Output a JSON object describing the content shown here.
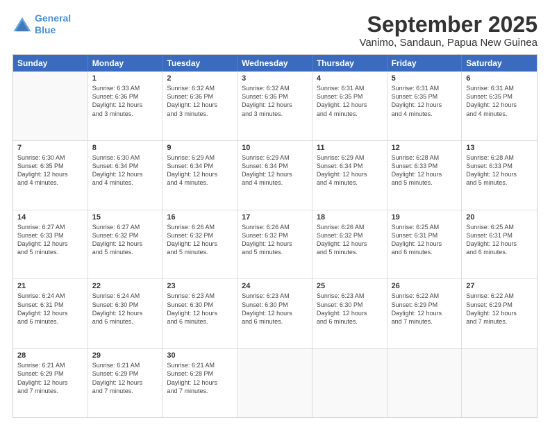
{
  "logo": {
    "line1": "General",
    "line2": "Blue"
  },
  "title": "September 2025",
  "subtitle": "Vanimo, Sandaun, Papua New Guinea",
  "header_days": [
    "Sunday",
    "Monday",
    "Tuesday",
    "Wednesday",
    "Thursday",
    "Friday",
    "Saturday"
  ],
  "weeks": [
    [
      {
        "day": "",
        "info": ""
      },
      {
        "day": "1",
        "info": "Sunrise: 6:33 AM\nSunset: 6:36 PM\nDaylight: 12 hours\nand 3 minutes."
      },
      {
        "day": "2",
        "info": "Sunrise: 6:32 AM\nSunset: 6:36 PM\nDaylight: 12 hours\nand 3 minutes."
      },
      {
        "day": "3",
        "info": "Sunrise: 6:32 AM\nSunset: 6:36 PM\nDaylight: 12 hours\nand 3 minutes."
      },
      {
        "day": "4",
        "info": "Sunrise: 6:31 AM\nSunset: 6:35 PM\nDaylight: 12 hours\nand 4 minutes."
      },
      {
        "day": "5",
        "info": "Sunrise: 6:31 AM\nSunset: 6:35 PM\nDaylight: 12 hours\nand 4 minutes."
      },
      {
        "day": "6",
        "info": "Sunrise: 6:31 AM\nSunset: 6:35 PM\nDaylight: 12 hours\nand 4 minutes."
      }
    ],
    [
      {
        "day": "7",
        "info": "Sunrise: 6:30 AM\nSunset: 6:35 PM\nDaylight: 12 hours\nand 4 minutes."
      },
      {
        "day": "8",
        "info": "Sunrise: 6:30 AM\nSunset: 6:34 PM\nDaylight: 12 hours\nand 4 minutes."
      },
      {
        "day": "9",
        "info": "Sunrise: 6:29 AM\nSunset: 6:34 PM\nDaylight: 12 hours\nand 4 minutes."
      },
      {
        "day": "10",
        "info": "Sunrise: 6:29 AM\nSunset: 6:34 PM\nDaylight: 12 hours\nand 4 minutes."
      },
      {
        "day": "11",
        "info": "Sunrise: 6:29 AM\nSunset: 6:34 PM\nDaylight: 12 hours\nand 4 minutes."
      },
      {
        "day": "12",
        "info": "Sunrise: 6:28 AM\nSunset: 6:33 PM\nDaylight: 12 hours\nand 5 minutes."
      },
      {
        "day": "13",
        "info": "Sunrise: 6:28 AM\nSunset: 6:33 PM\nDaylight: 12 hours\nand 5 minutes."
      }
    ],
    [
      {
        "day": "14",
        "info": "Sunrise: 6:27 AM\nSunset: 6:33 PM\nDaylight: 12 hours\nand 5 minutes."
      },
      {
        "day": "15",
        "info": "Sunrise: 6:27 AM\nSunset: 6:32 PM\nDaylight: 12 hours\nand 5 minutes."
      },
      {
        "day": "16",
        "info": "Sunrise: 6:26 AM\nSunset: 6:32 PM\nDaylight: 12 hours\nand 5 minutes."
      },
      {
        "day": "17",
        "info": "Sunrise: 6:26 AM\nSunset: 6:32 PM\nDaylight: 12 hours\nand 5 minutes."
      },
      {
        "day": "18",
        "info": "Sunrise: 6:26 AM\nSunset: 6:32 PM\nDaylight: 12 hours\nand 5 minutes."
      },
      {
        "day": "19",
        "info": "Sunrise: 6:25 AM\nSunset: 6:31 PM\nDaylight: 12 hours\nand 6 minutes."
      },
      {
        "day": "20",
        "info": "Sunrise: 6:25 AM\nSunset: 6:31 PM\nDaylight: 12 hours\nand 6 minutes."
      }
    ],
    [
      {
        "day": "21",
        "info": "Sunrise: 6:24 AM\nSunset: 6:31 PM\nDaylight: 12 hours\nand 6 minutes."
      },
      {
        "day": "22",
        "info": "Sunrise: 6:24 AM\nSunset: 6:30 PM\nDaylight: 12 hours\nand 6 minutes."
      },
      {
        "day": "23",
        "info": "Sunrise: 6:23 AM\nSunset: 6:30 PM\nDaylight: 12 hours\nand 6 minutes."
      },
      {
        "day": "24",
        "info": "Sunrise: 6:23 AM\nSunset: 6:30 PM\nDaylight: 12 hours\nand 6 minutes."
      },
      {
        "day": "25",
        "info": "Sunrise: 6:23 AM\nSunset: 6:30 PM\nDaylight: 12 hours\nand 6 minutes."
      },
      {
        "day": "26",
        "info": "Sunrise: 6:22 AM\nSunset: 6:29 PM\nDaylight: 12 hours\nand 7 minutes."
      },
      {
        "day": "27",
        "info": "Sunrise: 6:22 AM\nSunset: 6:29 PM\nDaylight: 12 hours\nand 7 minutes."
      }
    ],
    [
      {
        "day": "28",
        "info": "Sunrise: 6:21 AM\nSunset: 6:29 PM\nDaylight: 12 hours\nand 7 minutes."
      },
      {
        "day": "29",
        "info": "Sunrise: 6:21 AM\nSunset: 6:29 PM\nDaylight: 12 hours\nand 7 minutes."
      },
      {
        "day": "30",
        "info": "Sunrise: 6:21 AM\nSunset: 6:28 PM\nDaylight: 12 hours\nand 7 minutes."
      },
      {
        "day": "",
        "info": ""
      },
      {
        "day": "",
        "info": ""
      },
      {
        "day": "",
        "info": ""
      },
      {
        "day": "",
        "info": ""
      }
    ]
  ]
}
